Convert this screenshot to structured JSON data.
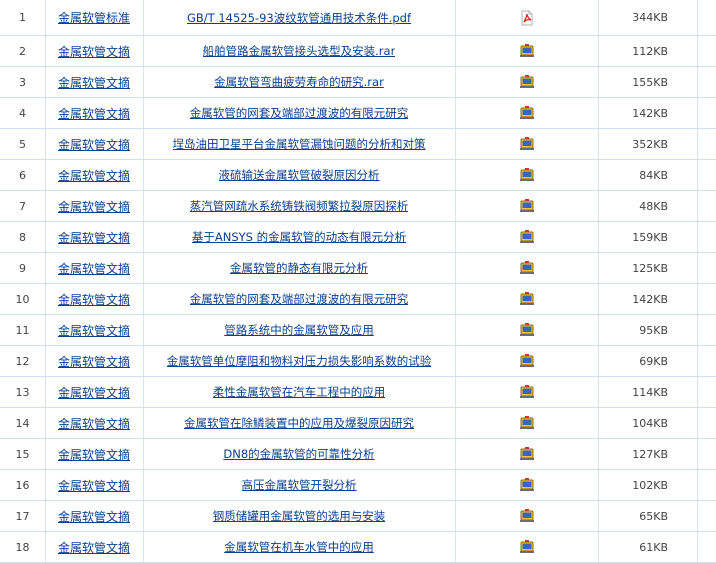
{
  "rows": [
    {
      "num": "1",
      "category": "金属软管标准",
      "title": "GB/T 14525-93波纹软管通用技术条件.pdf",
      "icon": "pdf-icon",
      "size": "344KB"
    },
    {
      "num": "2",
      "category": "金属软管文摘",
      "title": "船舶管路金属软管接头选型及安装.rar",
      "icon": "archive-icon",
      "size": "112KB"
    },
    {
      "num": "3",
      "category": "金属软管文摘",
      "title": "金属软管弯曲疲劳寿命的研究.rar",
      "icon": "archive-icon",
      "size": "155KB"
    },
    {
      "num": "4",
      "category": "金属软管文摘",
      "title": "金属软管的网套及端部过渡波的有限元研究",
      "icon": "archive-icon",
      "size": "142KB"
    },
    {
      "num": "5",
      "category": "金属软管文摘",
      "title": "埕岛油田卫星平台金属软管漏蚀问题的分析和对策",
      "icon": "archive-icon",
      "size": "352KB"
    },
    {
      "num": "6",
      "category": "金属软管文摘",
      "title": "液硫输送金属软管破裂原因分析",
      "icon": "archive-icon",
      "size": "84KB"
    },
    {
      "num": "7",
      "category": "金属软管文摘",
      "title": "蒸汽管网疏水系统铸铁阀频繁拉裂原因探析",
      "icon": "archive-icon",
      "size": "48KB"
    },
    {
      "num": "8",
      "category": "金属软管文摘",
      "title": "基于ANSYS 的金属软管的动态有限元分析",
      "icon": "archive-icon",
      "size": "159KB"
    },
    {
      "num": "9",
      "category": "金属软管文摘",
      "title": "金属软管的静态有限元分析",
      "icon": "archive-icon",
      "size": "125KB"
    },
    {
      "num": "10",
      "category": "金属软管文摘",
      "title": "金属软管的网套及端部过渡波的有限元研究",
      "icon": "archive-icon",
      "size": "142KB"
    },
    {
      "num": "11",
      "category": "金属软管文摘",
      "title": "管路系统中的金属软管及应用",
      "icon": "archive-icon",
      "size": "95KB"
    },
    {
      "num": "12",
      "category": "金属软管文摘",
      "title": "金属软管单位摩阻和物料对压力损失影响系数的试验",
      "icon": "archive-icon",
      "size": "69KB"
    },
    {
      "num": "13",
      "category": "金属软管文摘",
      "title": "柔性金属软管在汽车工程中的应用",
      "icon": "archive-icon",
      "size": "114KB"
    },
    {
      "num": "14",
      "category": "金属软管文摘",
      "title": "金属软管在除鳞装置中的应用及爆裂原因研究",
      "icon": "archive-icon",
      "size": "104KB"
    },
    {
      "num": "15",
      "category": "金属软管文摘",
      "title": "DN8的金属软管的可靠性分析",
      "icon": "archive-icon",
      "size": "127KB"
    },
    {
      "num": "16",
      "category": "金属软管文摘",
      "title": "高压金属软管开裂分析",
      "icon": "archive-icon",
      "size": "102KB"
    },
    {
      "num": "17",
      "category": "金属软管文摘",
      "title": "钢质储罐用金属软管的选用与安装",
      "icon": "archive-icon",
      "size": "65KB"
    },
    {
      "num": "18",
      "category": "金属软管文摘",
      "title": "金属软管在机车水管中的应用",
      "icon": "archive-icon",
      "size": "61KB"
    }
  ]
}
